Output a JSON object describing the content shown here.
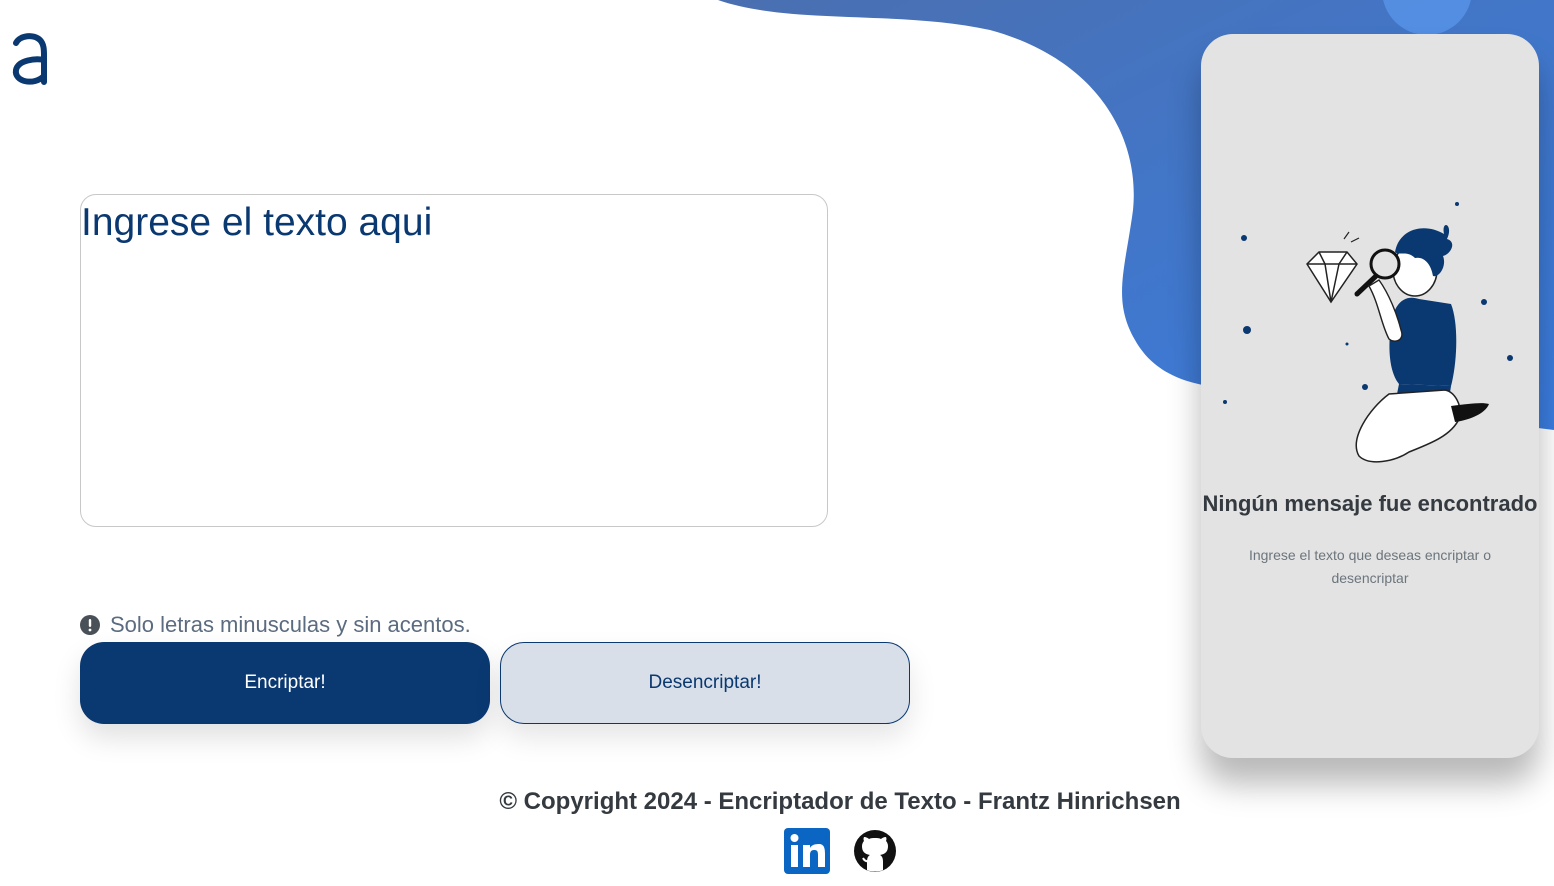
{
  "brand": {
    "logo_letter": "a"
  },
  "input": {
    "placeholder": "Ingrese el texto aqui"
  },
  "hint": {
    "icon": "info-icon",
    "text": "Solo letras minusculas y sin acentos."
  },
  "buttons": {
    "encrypt_label": "Encriptar!",
    "decrypt_label": "Desencriptar!"
  },
  "output_panel": {
    "title": "Ningún mensaje fue encontrado",
    "subtitle": "Ingrese el texto que deseas encriptar o desencriptar",
    "illustration": "person-with-magnifying-glass-and-diamond"
  },
  "footer": {
    "copyright": "© Copyright 2024 - Encriptador de Texto - Frantz Hinrichsen",
    "social": [
      {
        "name": "linkedin-icon"
      },
      {
        "name": "github-icon"
      }
    ]
  },
  "colors": {
    "primary": "#0a3871",
    "background_blob": "#3e7bd0",
    "panel": "#e3e3e3",
    "decrypt_bg": "#d8dfe8",
    "text_muted": "#6c757d"
  }
}
